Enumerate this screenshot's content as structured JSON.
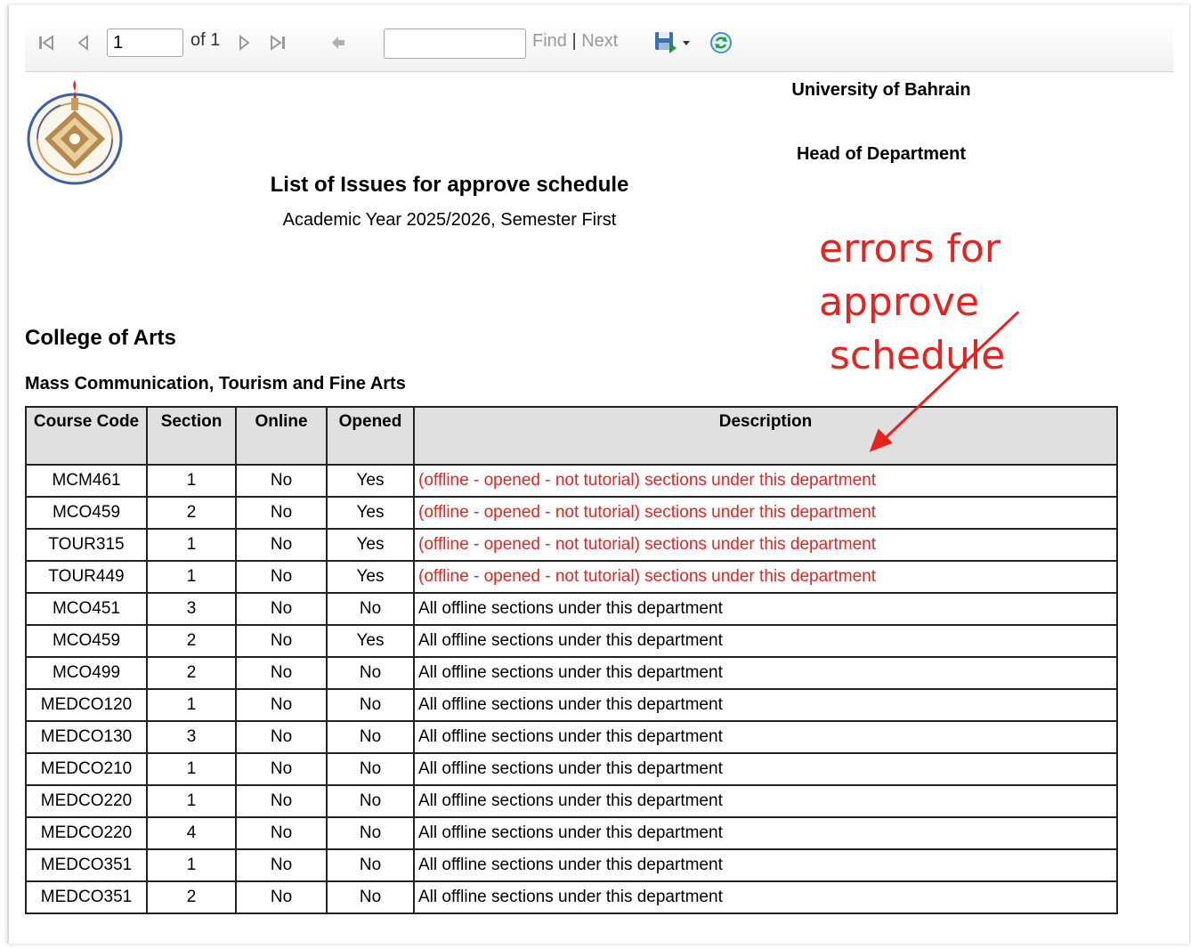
{
  "toolbar": {
    "page_value": "1",
    "page_of": "of 1",
    "find_label": "Find",
    "separator": "|",
    "next_label": "Next",
    "icons": [
      "first-page-icon",
      "previous-page-icon",
      "next-page-icon",
      "last-page-icon",
      "back-icon",
      "export-icon",
      "refresh-icon"
    ]
  },
  "header": {
    "university": "University of Bahrain",
    "role": "Head of Department",
    "title": "List of Issues for approve schedule",
    "subtitle": "Academic Year 2025/2026, Semester First"
  },
  "annotation": {
    "line1": "errors for approve",
    "line2": "schedule",
    "color": "#e8231f"
  },
  "college": "College of Arts",
  "department": "Mass Communication, Tourism and Fine Arts",
  "table": {
    "headers": {
      "course_code": "Course Code",
      "section": "Section",
      "online": "Online",
      "opened": "Opened",
      "description": "Description"
    },
    "rows": [
      {
        "code": "MCM461",
        "section": "1",
        "online": "No",
        "opened": "Yes",
        "description": "(offline - opened - not tutorial) sections under this department",
        "error": true
      },
      {
        "code": "MCO459",
        "section": "2",
        "online": "No",
        "opened": "Yes",
        "description": "(offline - opened - not tutorial) sections under this department",
        "error": true
      },
      {
        "code": "TOUR315",
        "section": "1",
        "online": "No",
        "opened": "Yes",
        "description": "(offline - opened - not tutorial) sections under this department",
        "error": true
      },
      {
        "code": "TOUR449",
        "section": "1",
        "online": "No",
        "opened": "Yes",
        "description": "(offline - opened - not tutorial) sections under this department",
        "error": true
      },
      {
        "code": "MCO451",
        "section": "3",
        "online": "No",
        "opened": "No",
        "description": "All offline sections under this department",
        "error": false
      },
      {
        "code": "MCO459",
        "section": "2",
        "online": "No",
        "opened": "Yes",
        "description": "All offline sections under this department",
        "error": false
      },
      {
        "code": "MCO499",
        "section": "2",
        "online": "No",
        "opened": "No",
        "description": "All offline sections under this department",
        "error": false
      },
      {
        "code": "MEDCO120",
        "section": "1",
        "online": "No",
        "opened": "No",
        "description": "All offline sections under this department",
        "error": false
      },
      {
        "code": "MEDCO130",
        "section": "3",
        "online": "No",
        "opened": "No",
        "description": "All offline sections under this department",
        "error": false
      },
      {
        "code": "MEDCO210",
        "section": "1",
        "online": "No",
        "opened": "No",
        "description": "All offline sections under this department",
        "error": false
      },
      {
        "code": "MEDCO220",
        "section": "1",
        "online": "No",
        "opened": "No",
        "description": "All offline sections under this department",
        "error": false
      },
      {
        "code": "MEDCO220",
        "section": "4",
        "online": "No",
        "opened": "No",
        "description": "All offline sections under this department",
        "error": false
      },
      {
        "code": "MEDCO351",
        "section": "1",
        "online": "No",
        "opened": "No",
        "description": "All offline sections under this department",
        "error": false
      },
      {
        "code": "MEDCO351",
        "section": "2",
        "online": "No",
        "opened": "No",
        "description": "All offline sections under this department",
        "error": false
      }
    ]
  }
}
